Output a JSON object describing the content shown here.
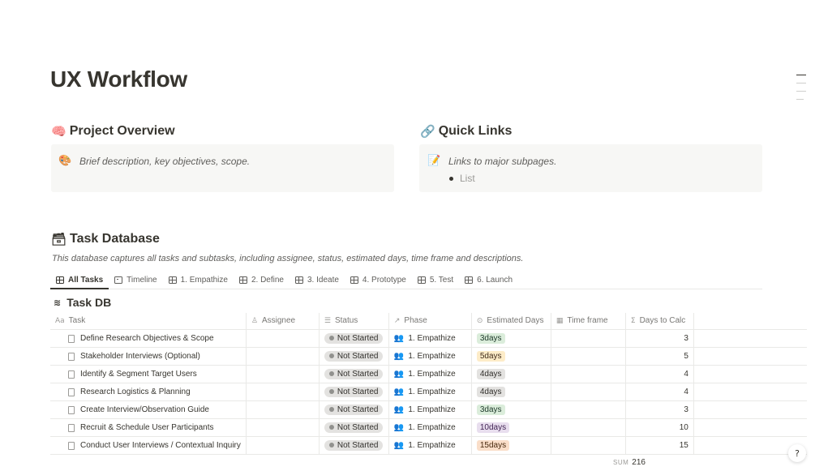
{
  "page": {
    "title": "UX Workflow"
  },
  "overview": {
    "emoji": "🧠",
    "title": "Project Overview",
    "callout_icon": "🎨",
    "callout_text": "Brief description, key objectives, scope."
  },
  "quick_links": {
    "emoji": "🔗",
    "title": "Quick Links",
    "callout_icon": "📝",
    "callout_text": "Links to major subpages.",
    "list_item": "List"
  },
  "task_database": {
    "emoji": "🗃",
    "title": "Task Database",
    "description": "This database captures all tasks and subtasks, including assignee, status, estimated days, time frame and descriptions."
  },
  "tabs": [
    {
      "label": "All Tasks",
      "icon": "table-icon",
      "active": true
    },
    {
      "label": "Timeline",
      "icon": "timeline-icon",
      "active": false
    },
    {
      "label": "1. Empathize",
      "icon": "table-icon",
      "active": false
    },
    {
      "label": "2. Define",
      "icon": "table-icon",
      "active": false
    },
    {
      "label": "3. Ideate",
      "icon": "table-icon",
      "active": false
    },
    {
      "label": "4. Prototype",
      "icon": "table-icon",
      "active": false
    },
    {
      "label": "5. Test",
      "icon": "table-icon",
      "active": false
    },
    {
      "label": "6. Launch",
      "icon": "table-icon",
      "active": false
    }
  ],
  "db": {
    "title": "Task DB",
    "icon": "stack-icon",
    "columns": [
      {
        "icon": "Aa",
        "label": "Task"
      },
      {
        "icon": "✈",
        "label": "Assignee"
      },
      {
        "icon": "≣",
        "label": "Status"
      },
      {
        "icon": "↗",
        "label": "Phase"
      },
      {
        "icon": "◉",
        "label": "Estimated Days"
      },
      {
        "icon": "▦",
        "label": "Time frame"
      },
      {
        "icon": "Σ",
        "label": "Days to Calc"
      }
    ],
    "rows": [
      {
        "task": "Define Research Objectives & Scope",
        "assignee": "",
        "status": "Not Started",
        "phase": "1. Empathize",
        "days": "3days",
        "days_color": "#dbeddb",
        "days_text": "#1c3829",
        "timeframe": "",
        "calc": "3"
      },
      {
        "task": "Stakeholder Interviews (Optional)",
        "assignee": "",
        "status": "Not Started",
        "phase": "1. Empathize",
        "days": "5days",
        "days_color": "#fdecc8",
        "days_text": "#402c1b",
        "timeframe": "",
        "calc": "5"
      },
      {
        "task": "Identify & Segment Target Users",
        "assignee": "",
        "status": "Not Started",
        "phase": "1. Empathize",
        "days": "4days",
        "days_color": "#e3e2e0",
        "days_text": "#32302c",
        "timeframe": "",
        "calc": "4"
      },
      {
        "task": "Research Logistics & Planning",
        "assignee": "",
        "status": "Not Started",
        "phase": "1. Empathize",
        "days": "4days",
        "days_color": "#e3e2e0",
        "days_text": "#32302c",
        "timeframe": "",
        "calc": "4"
      },
      {
        "task": "Create Interview/Observation Guide",
        "assignee": "",
        "status": "Not Started",
        "phase": "1. Empathize",
        "days": "3days",
        "days_color": "#dbeddb",
        "days_text": "#1c3829",
        "timeframe": "",
        "calc": "3"
      },
      {
        "task": "Recruit & Schedule User Participants",
        "assignee": "",
        "status": "Not Started",
        "phase": "1. Empathize",
        "days": "10days",
        "days_color": "#e8deee",
        "days_text": "#412454",
        "timeframe": "",
        "calc": "10"
      },
      {
        "task": "Conduct User Interviews / Contextual Inquiry",
        "assignee": "",
        "status": "Not Started",
        "phase": "1. Empathize",
        "days": "15days",
        "days_color": "#fadec9",
        "days_text": "#49290e",
        "timeframe": "",
        "calc": "15"
      }
    ],
    "sum_label": "SUM",
    "sum_value": "216"
  }
}
